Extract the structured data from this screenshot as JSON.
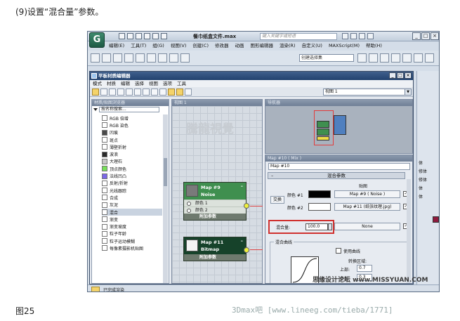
{
  "captions": {
    "step": "(9)设置“混合量”参数。",
    "figure": "图25",
    "watermark": "3Dmax吧 [www.lineeg.com/tieba/1771]",
    "site_watermark": "思缘设计论坛 www.MISSYUAN.COM"
  },
  "max": {
    "title": "餐巾纸盒文件.max",
    "search_placeholder": "键入关键字或短语",
    "menu": [
      "编辑(E)",
      "工具(T)",
      "组(G)",
      "视图(V)",
      "创建(C)",
      "修改器",
      "动画",
      "图形编辑器",
      "渲染(R)",
      "自定义(U)",
      "MAXScript(M)",
      "帮助(H)"
    ],
    "selection_set_placeholder": "创建选择集"
  },
  "slate": {
    "title": "平板材质编辑器",
    "menu": [
      "模式",
      "材质",
      "编辑",
      "选择",
      "视图",
      "选项",
      "工具"
    ],
    "view_dropdown": "视图 1",
    "browser": {
      "header": "材质/贴图浏览器",
      "search_placeholder": "按名称搜索...",
      "items": [
        {
          "label": "RGB 倍增",
          "color": "#ffffff"
        },
        {
          "label": "RGB 染色",
          "color": "#ffffff"
        },
        {
          "label": "凹痕",
          "color": "#4a4a4a"
        },
        {
          "label": "斑点",
          "color": "#ffffff"
        },
        {
          "label": "薄壁折射",
          "color": "#ffffff"
        },
        {
          "label": "波浪",
          "color": "#2a2a2a"
        },
        {
          "label": "大理石",
          "color": "#c9c9c9"
        },
        {
          "label": "顶点颜色",
          "color": "#78e05a"
        },
        {
          "label": "法线凹凸",
          "color": "#7c68e8"
        },
        {
          "label": "反射/折射",
          "color": "#ffffff"
        },
        {
          "label": "光线跟踪",
          "color": "#ffffff"
        },
        {
          "label": "合成",
          "color": "#ffffff"
        },
        {
          "label": "灰泥",
          "color": "#ffffff"
        },
        {
          "label": "混合",
          "color": "#ffffff"
        },
        {
          "label": "渐变",
          "color": "#ffffff"
        },
        {
          "label": "渐变坡度",
          "color": "#ffffff"
        },
        {
          "label": "粒子年龄",
          "color": "#ffffff"
        },
        {
          "label": "粒子运动模糊",
          "color": "#ffffff"
        },
        {
          "label": "每像素摄影机贴图",
          "color": "#ffffff"
        }
      ],
      "selected_index": 13
    },
    "view_panel": {
      "header": "视图 1",
      "watermark": "騰龍視覺",
      "nodes": [
        {
          "line1": "Map #9",
          "line2": "Noise",
          "slots": [
            "颜色 1",
            "颜色 2"
          ],
          "footer": "附加参数",
          "color": "#3f8f4f"
        },
        {
          "line1": "Map #11",
          "line2": "Bitmap",
          "slots": [],
          "footer": "附加参数",
          "color": "#16422a"
        }
      ]
    },
    "navigator": {
      "header": "导航器"
    },
    "params": {
      "header": "Map #10  ( Mix )",
      "map_name": "Map #10",
      "rollout": "混合参数",
      "maps_label": "贴图",
      "swap_label": "交换",
      "color1_label": "颜色 #1",
      "color2_label": "颜色 #2",
      "color1_value": "#000000",
      "color2_value": "#ffffff",
      "map1": "Map #9 ( Noise )",
      "map2": "Map #11 (纸张纹理.jpg)",
      "mix_label": "混合量:",
      "mix_value": "100.0",
      "mix_map": "None",
      "curve_group": "混合曲线",
      "use_curve_label": "使用曲线",
      "transition_label": "转换区域:",
      "upper_label": "上部:",
      "upper_value": "0.7",
      "lower_label": "下部:",
      "lower_value": "0.3"
    }
  },
  "command_panel": {
    "tabs": [
      "体",
      "修体",
      "修体",
      "体",
      "体"
    ]
  },
  "status": {
    "text": "已完成渲染"
  }
}
